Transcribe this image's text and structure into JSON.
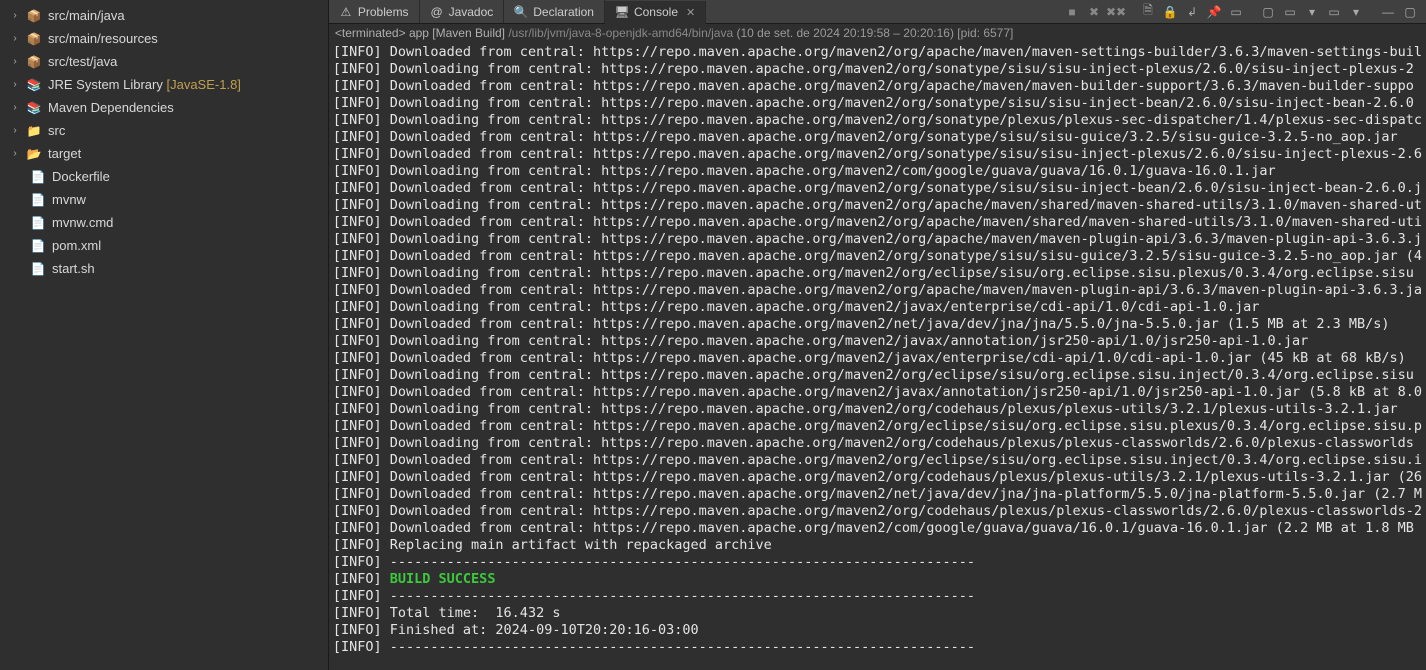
{
  "sidebar": {
    "items": [
      {
        "icon": "pkg",
        "label": "src/main/java",
        "extra": "",
        "arrow": ">"
      },
      {
        "icon": "pkg",
        "label": "src/main/resources",
        "extra": "",
        "arrow": ">"
      },
      {
        "icon": "pkg",
        "label": "src/test/java",
        "extra": "",
        "arrow": ">"
      },
      {
        "icon": "lib",
        "label": "JRE System Library",
        "extra": " [JavaSE-1.8]",
        "arrow": ">"
      },
      {
        "icon": "lib",
        "label": "Maven Dependencies",
        "extra": "",
        "arrow": ">"
      },
      {
        "icon": "fld",
        "label": "src",
        "extra": "",
        "arrow": ">"
      },
      {
        "icon": "fld-open",
        "label": "target",
        "extra": "",
        "arrow": ">"
      },
      {
        "icon": "file",
        "label": "Dockerfile",
        "extra": "",
        "arrow": ""
      },
      {
        "icon": "file",
        "label": "mvnw",
        "extra": "",
        "arrow": ""
      },
      {
        "icon": "file",
        "label": "mvnw.cmd",
        "extra": "",
        "arrow": ""
      },
      {
        "icon": "xml",
        "label": "pom.xml",
        "extra": "",
        "arrow": ""
      },
      {
        "icon": "file",
        "label": "start.sh",
        "extra": "",
        "arrow": ""
      }
    ]
  },
  "tabs": [
    {
      "icon": "problems-icon",
      "label": "Problems",
      "active": false,
      "closable": false
    },
    {
      "icon": "javadoc-icon",
      "label": "Javadoc",
      "active": false,
      "closable": false
    },
    {
      "icon": "declaration-icon",
      "label": "Declaration",
      "active": false,
      "closable": false
    },
    {
      "icon": "console-icon",
      "label": "Console",
      "active": true,
      "closable": true
    }
  ],
  "terminated": {
    "prefix": "<terminated>",
    "name": "app [Maven Build]",
    "path": "/usr/lib/jvm/java-8-openjdk-amd64/bin/java",
    "meta": "(10 de set. de 2024 20:19:58 – 20:20:16) [pid: 6577]"
  },
  "console_lines": [
    "[INFO] Downloaded from central: https://repo.maven.apache.org/maven2/org/apache/maven/maven-settings-builder/3.6.3/maven-settings-buil",
    "[INFO] Downloading from central: https://repo.maven.apache.org/maven2/org/sonatype/sisu/sisu-inject-plexus/2.6.0/sisu-inject-plexus-2",
    "[INFO] Downloaded from central: https://repo.maven.apache.org/maven2/org/apache/maven/maven-builder-support/3.6.3/maven-builder-suppo",
    "[INFO] Downloading from central: https://repo.maven.apache.org/maven2/org/sonatype/sisu/sisu-inject-bean/2.6.0/sisu-inject-bean-2.6.0",
    "[INFO] Downloading from central: https://repo.maven.apache.org/maven2/org/sonatype/plexus/plexus-sec-dispatcher/1.4/plexus-sec-dispatc",
    "[INFO] Downloaded from central: https://repo.maven.apache.org/maven2/org/sonatype/sisu/sisu-guice/3.2.5/sisu-guice-3.2.5-no_aop.jar",
    "[INFO] Downloaded from central: https://repo.maven.apache.org/maven2/org/sonatype/sisu/sisu-inject-plexus/2.6.0/sisu-inject-plexus-2.6",
    "[INFO] Downloading from central: https://repo.maven.apache.org/maven2/com/google/guava/guava/16.0.1/guava-16.0.1.jar",
    "[INFO] Downloaded from central: https://repo.maven.apache.org/maven2/org/sonatype/sisu/sisu-inject-bean/2.6.0/sisu-inject-bean-2.6.0.j",
    "[INFO] Downloading from central: https://repo.maven.apache.org/maven2/org/apache/maven/shared/maven-shared-utils/3.1.0/maven-shared-ut",
    "[INFO] Downloaded from central: https://repo.maven.apache.org/maven2/org/apache/maven/shared/maven-shared-utils/3.1.0/maven-shared-uti",
    "[INFO] Downloading from central: https://repo.maven.apache.org/maven2/org/apache/maven/maven-plugin-api/3.6.3/maven-plugin-api-3.6.3.j",
    "[INFO] Downloaded from central: https://repo.maven.apache.org/maven2/org/sonatype/sisu/sisu-guice/3.2.5/sisu-guice-3.2.5-no_aop.jar (4",
    "[INFO] Downloading from central: https://repo.maven.apache.org/maven2/org/eclipse/sisu/org.eclipse.sisu.plexus/0.3.4/org.eclipse.sisu",
    "[INFO] Downloaded from central: https://repo.maven.apache.org/maven2/org/apache/maven/maven-plugin-api/3.6.3/maven-plugin-api-3.6.3.ja",
    "[INFO] Downloading from central: https://repo.maven.apache.org/maven2/javax/enterprise/cdi-api/1.0/cdi-api-1.0.jar",
    "[INFO] Downloaded from central: https://repo.maven.apache.org/maven2/net/java/dev/jna/jna/5.5.0/jna-5.5.0.jar (1.5 MB at 2.3 MB/s)",
    "[INFO] Downloading from central: https://repo.maven.apache.org/maven2/javax/annotation/jsr250-api/1.0/jsr250-api-1.0.jar",
    "[INFO] Downloaded from central: https://repo.maven.apache.org/maven2/javax/enterprise/cdi-api/1.0/cdi-api-1.0.jar (45 kB at 68 kB/s)",
    "[INFO] Downloading from central: https://repo.maven.apache.org/maven2/org/eclipse/sisu/org.eclipse.sisu.inject/0.3.4/org.eclipse.sisu",
    "[INFO] Downloaded from central: https://repo.maven.apache.org/maven2/javax/annotation/jsr250-api/1.0/jsr250-api-1.0.jar (5.8 kB at 8.0",
    "[INFO] Downloading from central: https://repo.maven.apache.org/maven2/org/codehaus/plexus/plexus-utils/3.2.1/plexus-utils-3.2.1.jar",
    "[INFO] Downloaded from central: https://repo.maven.apache.org/maven2/org/eclipse/sisu/org.eclipse.sisu.plexus/0.3.4/org.eclipse.sisu.p",
    "[INFO] Downloading from central: https://repo.maven.apache.org/maven2/org/codehaus/plexus/plexus-classworlds/2.6.0/plexus-classworlds",
    "[INFO] Downloaded from central: https://repo.maven.apache.org/maven2/org/eclipse/sisu/org.eclipse.sisu.inject/0.3.4/org.eclipse.sisu.i",
    "[INFO] Downloaded from central: https://repo.maven.apache.org/maven2/org/codehaus/plexus/plexus-utils/3.2.1/plexus-utils-3.2.1.jar (26",
    "[INFO] Downloaded from central: https://repo.maven.apache.org/maven2/net/java/dev/jna/jna-platform/5.5.0/jna-platform-5.5.0.jar (2.7 M",
    "[INFO] Downloaded from central: https://repo.maven.apache.org/maven2/org/codehaus/plexus/plexus-classworlds/2.6.0/plexus-classworlds-2",
    "[INFO] Downloaded from central: https://repo.maven.apache.org/maven2/com/google/guava/guava/16.0.1/guava-16.0.1.jar (2.2 MB at 1.8 MB",
    "[INFO] Replacing main artifact with repackaged archive",
    "[INFO] ------------------------------------------------------------------------",
    "[INFO] |SUCCESS|BUILD SUCCESS",
    "[INFO] ------------------------------------------------------------------------",
    "[INFO] Total time:  16.432 s",
    "[INFO] Finished at: 2024-09-10T20:20:16-03:00",
    "[INFO] ------------------------------------------------------------------------"
  ]
}
